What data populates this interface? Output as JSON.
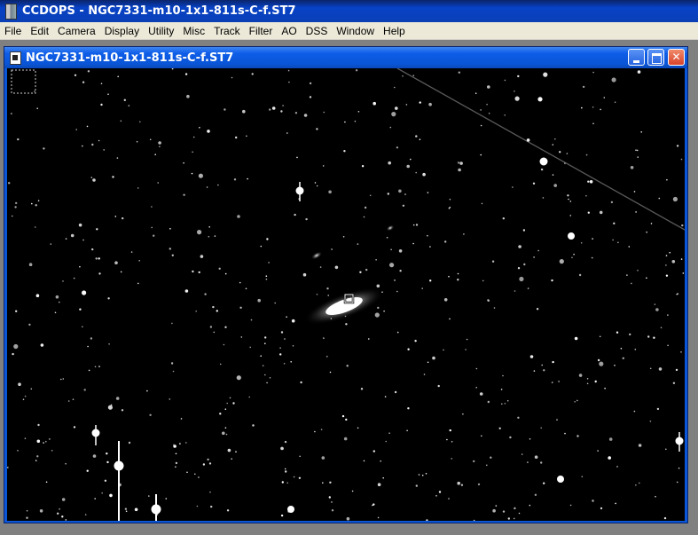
{
  "app": {
    "title": "CCDOPS - NGC7331-m10-1x1-811s-C-f.ST7"
  },
  "menu": {
    "items": [
      "File",
      "Edit",
      "Camera",
      "Display",
      "Utility",
      "Misc",
      "Track",
      "Filter",
      "AO",
      "DSS",
      "Window",
      "Help"
    ]
  },
  "child_window": {
    "title": "NGC7331-m10-1x1-811s-C-f.ST7",
    "controls": [
      "minimize",
      "maximize",
      "close"
    ]
  },
  "image": {
    "subject": "NGC7331",
    "colors": {
      "sky": "#000000",
      "titlebar": "#0a5ce8",
      "menubar": "#ece9d8"
    },
    "icons": [
      "app-icon",
      "document-icon",
      "minimize-icon",
      "maximize-icon",
      "close-icon",
      "cursor-box-icon"
    ]
  }
}
